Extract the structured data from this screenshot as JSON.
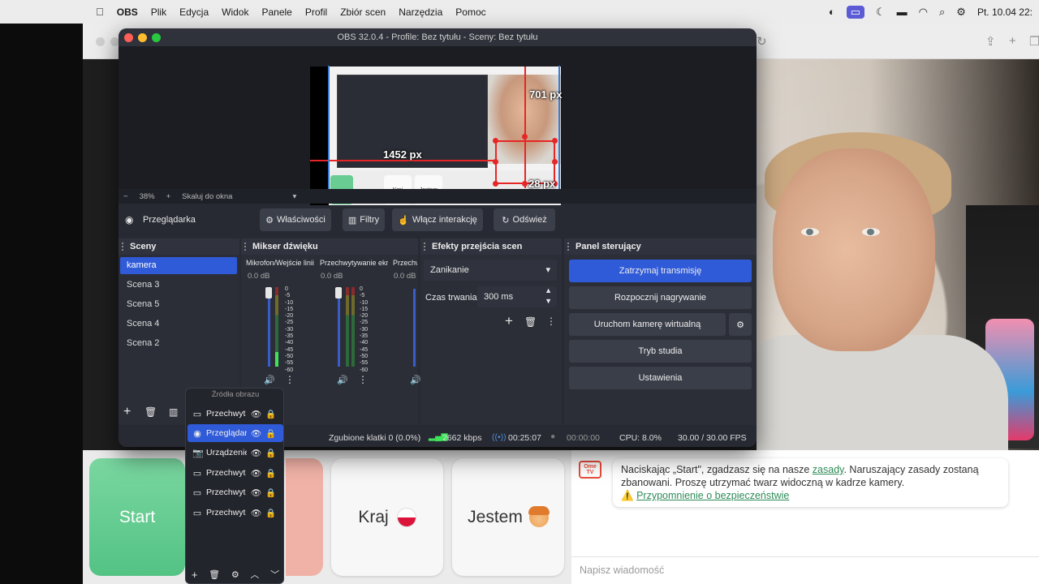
{
  "menubar": {
    "app": "OBS",
    "items": [
      "Plik",
      "Edycja",
      "Widok",
      "Panele",
      "Profil",
      "Zbiór scen",
      "Narzędzia",
      "Pomoc"
    ],
    "datetime": "Pt. 10.04  22:"
  },
  "obs": {
    "title": "OBS 32.0.4 - Profile: Bez tytułu - Sceny: Bez tytułu",
    "preview": {
      "label_height": "701 px",
      "label_width": "1452 px",
      "label_bottom": "28 px",
      "mini_buttons": [
        "Start",
        "Kraj",
        "Jestem"
      ]
    },
    "zoom": {
      "minus": "−",
      "value": "38%",
      "plus": "+",
      "mode": "Skaluj do okna"
    },
    "source_toolbar": {
      "selected_source": "Przeglądarka",
      "properties": "Właściwości",
      "filters": "Filtry",
      "interact": "Włącz interakcję",
      "refresh": "Odśwież"
    },
    "scenes": {
      "title": "Sceny",
      "items": [
        "kamera",
        "Scena 3",
        "Scena 5",
        "Scena 4",
        "Scena 2"
      ]
    },
    "mixer": {
      "title": "Mikser dźwięku",
      "channels": [
        {
          "name": "Mikrofon/Wejście linii",
          "db": "0.0 dB"
        },
        {
          "name": "Przechwytywanie ekranu",
          "db": "0.0 dB"
        },
        {
          "name": "Przechw",
          "db": "0.0 dB"
        }
      ],
      "scale": [
        "0",
        "-5",
        "-10",
        "-15",
        "-20",
        "-25",
        "-30",
        "-35",
        "-40",
        "-45",
        "-50",
        "-55",
        "-60"
      ]
    },
    "transitions": {
      "title": "Efekty przejścia scen",
      "selected": "Zanikanie",
      "duration_label": "Czas trwania",
      "duration_value": "300 ms"
    },
    "controls": {
      "title": "Panel sterujący",
      "stop_stream": "Zatrzymaj transmisję",
      "start_recording": "Rozpocznij nagrywanie",
      "virtual_camera": "Uruchom kamerę wirtualną",
      "studio_mode": "Tryb studia",
      "settings": "Ustawienia"
    },
    "status": {
      "dropped_frames": "Zgubione klatki 0 (0.0%)",
      "bitrate": "2662 kbps",
      "stream_time": "00:25:07",
      "record_time": "00:00:00",
      "cpu": "CPU: 8.0%",
      "fps": "30.00 / 30.00 FPS"
    },
    "sources_popup": {
      "title": "Źródła obrazu",
      "items": [
        {
          "name": "Przechwyt",
          "icon": "monitor-icon",
          "selected": false
        },
        {
          "name": "Przeglądar",
          "icon": "globe-icon",
          "selected": true
        },
        {
          "name": "Urządzenie",
          "icon": "camera-icon",
          "selected": false
        },
        {
          "name": "Przechwyt",
          "icon": "monitor-icon",
          "selected": false
        },
        {
          "name": "Przechwyt",
          "icon": "monitor-icon",
          "selected": false
        },
        {
          "name": "Przechwyt",
          "icon": "monitor-icon",
          "selected": false
        }
      ]
    }
  },
  "ome": {
    "buttons": {
      "start": "Start",
      "kraj": "Kraj",
      "jestem": "Jestem"
    },
    "logo": "Ome TV",
    "chat": {
      "msg_part1": "Naciskając „Start\", zgadzasz się na nasze ",
      "rules_link": "zasady",
      "msg_part2": ". Naruszający zasady zostaną zbanowani. Proszę utrzymać twarz widoczną w kadrze kamery.",
      "safety_link": "Przypomnienie o bezpieczeństwie",
      "input_placeholder": "Napisz wiadomość"
    }
  },
  "colors": {
    "obs_accent": "#2f5ad8",
    "start_green": "#5fcb8c",
    "ome_red": "#e94c3a",
    "link_green": "#2e8b57"
  }
}
